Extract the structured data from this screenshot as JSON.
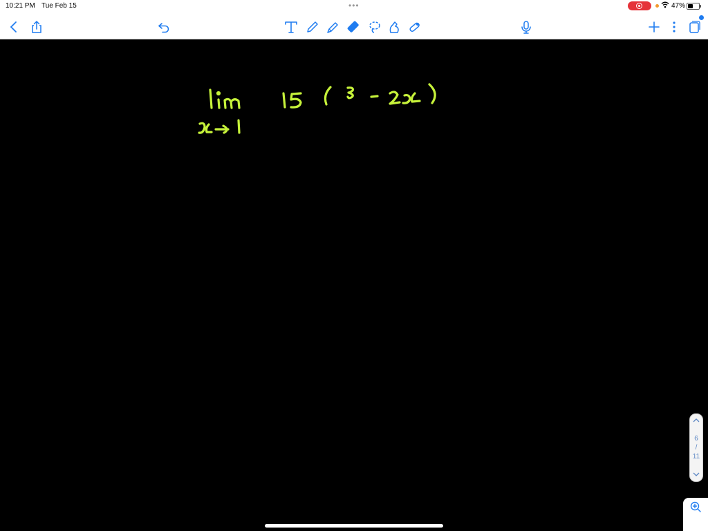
{
  "status_bar": {
    "time": "10:21 PM",
    "date": "Tue Feb 15",
    "battery": "47%",
    "multitask_dots": "•••"
  },
  "toolbar": {
    "icons": [
      "back-icon",
      "share-icon",
      "undo-icon",
      "text-tool-icon",
      "pen-tool-icon",
      "highlighter-tool-icon",
      "eraser-tool-icon",
      "lasso-tool-icon",
      "shape-tool-icon",
      "laser-pointer-icon",
      "microphone-icon",
      "add-page-icon",
      "more-options-icon",
      "page-thumbnails-icon"
    ],
    "accent": "#1f7cf0"
  },
  "canvas": {
    "background": "#000000",
    "ink_color": "#c6f23a",
    "handwriting": {
      "expression": "lim 15 (3 - 2x)",
      "subscript": "x→1"
    }
  },
  "pagination": {
    "current": "6",
    "separator": "/",
    "total": "11"
  }
}
